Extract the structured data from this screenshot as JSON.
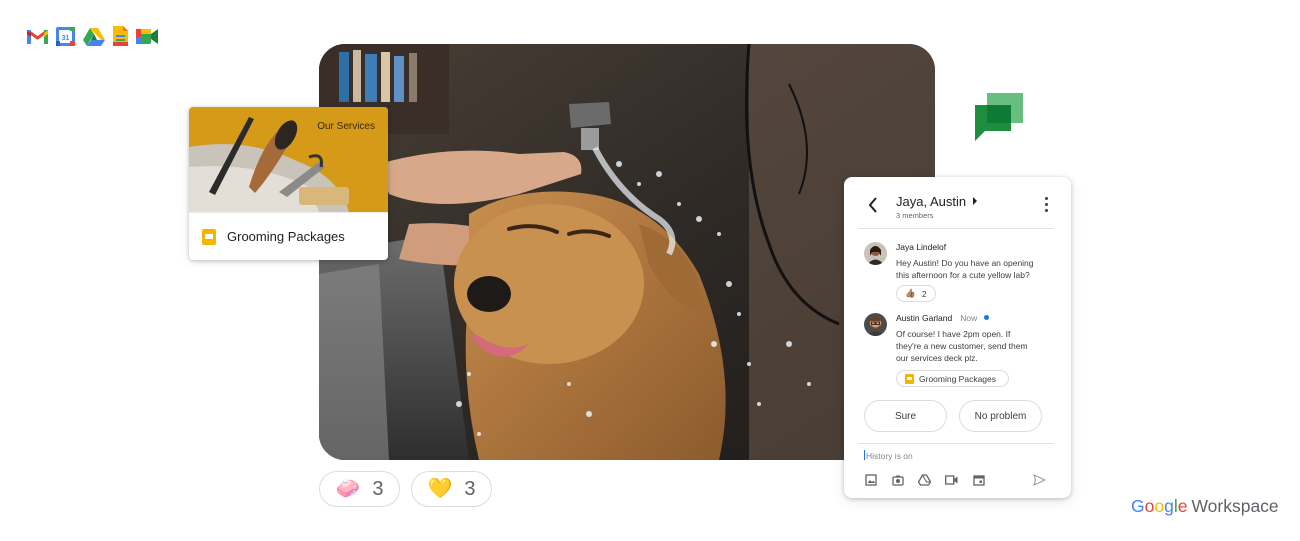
{
  "apps": [
    {
      "icon": "gmail-icon"
    },
    {
      "icon": "calendar-icon",
      "label": "31"
    },
    {
      "icon": "drive-icon"
    },
    {
      "icon": "docs-icon"
    },
    {
      "icon": "meet-icon"
    }
  ],
  "slide_card": {
    "thumbnail_title": "Our Services",
    "file_name": "Grooming Packages"
  },
  "reactions": [
    {
      "emoji": "🧼",
      "count": "3"
    },
    {
      "emoji": "💛",
      "count": "3"
    }
  ],
  "chat": {
    "title": "Jaya, Austin",
    "subtitle": "3 members",
    "messages": [
      {
        "author": "Jaya Lindelof",
        "time": "",
        "text": "Hey Austin! Do you have an opening\nthis afternoon for a cute yellow lab?",
        "reaction": {
          "emoji": "👍🏽",
          "count": "2"
        }
      },
      {
        "author": "Austin Garland",
        "time": "Now",
        "text": "Of course! I have 2pm open. If\nthey're a new customer, send them\nour services deck plz.",
        "attachment": "Grooming Packages"
      }
    ],
    "quick_replies": [
      "Sure",
      "No problem"
    ],
    "compose_placeholder": "History is on",
    "tools": [
      "image-icon",
      "camera-icon",
      "drive-icon",
      "video-icon",
      "calendar-icon"
    ]
  },
  "brand": {
    "google_letters": [
      "G",
      "o",
      "o",
      "g",
      "l",
      "e"
    ],
    "product": "Workspace"
  },
  "colors": {
    "google_blue": "#4285f4",
    "google_red": "#ea4335",
    "google_yellow": "#fbbc04",
    "google_green": "#34a853",
    "slides_yellow": "#f4b400",
    "presence_dot": "#1a73e8"
  }
}
